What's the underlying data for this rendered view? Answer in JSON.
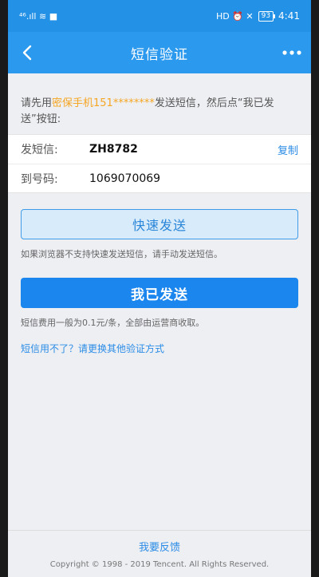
{
  "status_bar": {
    "signal": "⁴⁶.ıll ≋ ■",
    "right_icons": "HD ⏰ ✕",
    "battery": "93",
    "time": "4:41"
  },
  "nav": {
    "title": "短信验证",
    "back_icon": "chevron-left-icon",
    "more_icon": "more-dots-icon"
  },
  "instruction": {
    "prefix": "请先用",
    "phone": "密保手机151********",
    "suffix": "发送短信，然后点“我已发送”按钮:"
  },
  "send_info": {
    "content_label": "发短信:",
    "content_value": "ZH8782",
    "copy_label": "复制",
    "number_label": "到号码:",
    "number_value": "1069070069"
  },
  "quick_send": {
    "label": "快速发送",
    "hint": "如果浏览器不支持快速发送短信，请手动发送短信。"
  },
  "confirm": {
    "label": "我已发送",
    "fee_hint": "短信费用一般为0.1元/条，全部由运营商收取。"
  },
  "alt_method": "短信用不了？请更换其他验证方式",
  "footer": {
    "feedback": "我要反馈",
    "copyright": "Copyright © 1998 - 2019 Tencent. All Rights Reserved."
  },
  "colors": {
    "header": "#2b99ee",
    "primary_button": "#1b86ee",
    "link": "#2b8ce6",
    "highlight": "#f5a623"
  }
}
